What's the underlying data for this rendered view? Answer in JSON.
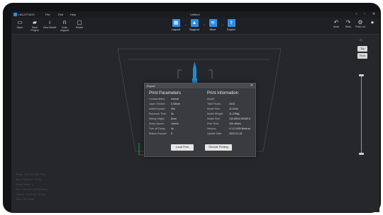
{
  "app": {
    "name": "HALOT BOX",
    "window_title": "Untitled"
  },
  "menu": [
    "File",
    "Edit",
    "Help"
  ],
  "toolbar": {
    "left": [
      {
        "icon": "folder-open-icon",
        "label": "Open"
      },
      {
        "icon": "save-icon",
        "label": "Save Project"
      },
      {
        "icon": "view-model-icon",
        "label": "View Model"
      },
      {
        "icon": "auto-support-icon",
        "label": "Auto support"
      },
      {
        "icon": "printer-icon",
        "label": "Printer"
      }
    ],
    "stages": [
      {
        "icon": "layout-icon",
        "label": "Layout"
      },
      {
        "icon": "support-icon",
        "label": "Support"
      },
      {
        "icon": "slice-icon",
        "label": "Slice"
      },
      {
        "icon": "export-icon",
        "label": "Export"
      }
    ],
    "right": [
      {
        "icon": "undo-icon",
        "label": "Undo"
      },
      {
        "icon": "redo-icon",
        "label": "Redo"
      },
      {
        "icon": "print-list-icon",
        "label": "Print List"
      }
    ]
  },
  "dialog": {
    "title": "Export",
    "left_title": "Print Parameters",
    "left_rows": [
      [
        "Consumables:",
        "normal"
      ],
      [
        "Layer Thickne:",
        "0.05mm"
      ],
      [
        "Initial Exposur:",
        "40s"
      ],
      [
        "Exposure Time:",
        "3s"
      ],
      [
        "Rising Height:",
        "6mm"
      ],
      [
        "Motor Speed:",
        "1mm/s"
      ],
      [
        "Turn off Delay:",
        "4s"
      ],
      [
        "Bottom Exposu:",
        "5"
      ]
    ],
    "right_title": "Print Information",
    "right_rows": [
      [
        "Model:",
        ""
      ],
      [
        "Total Floors:",
        "2410"
      ],
      [
        "Model Size:",
        "11.03ml"
      ],
      [
        "Model Weight:",
        "11.239kg"
      ],
      [
        "Model Size:",
        "130.89X4.95X89.5"
      ],
      [
        "Print Time:",
        "10h 40min"
      ],
      [
        "Version:",
        "V.1.2.0491.Beta.sn"
      ],
      [
        "Update Date:",
        "2022-01-18"
      ]
    ],
    "buttons": [
      "Local Print",
      "Remote Printing"
    ]
  },
  "side_panel": {
    "top_label": "Top",
    "front_label": "Front"
  },
  "status_lines": [
    "Printer: HALOT-ONE PRO",
    "Slice Thickness: 50um",
    "Model Count: 1",
    "Size: 130.89X4.95X89.5mm",
    "Volume: 11.03 ml / 11.24 g",
    "Time: 10h 40min"
  ],
  "colors": {
    "accent": "#2b8ee8",
    "model": "#1f8bd6"
  }
}
